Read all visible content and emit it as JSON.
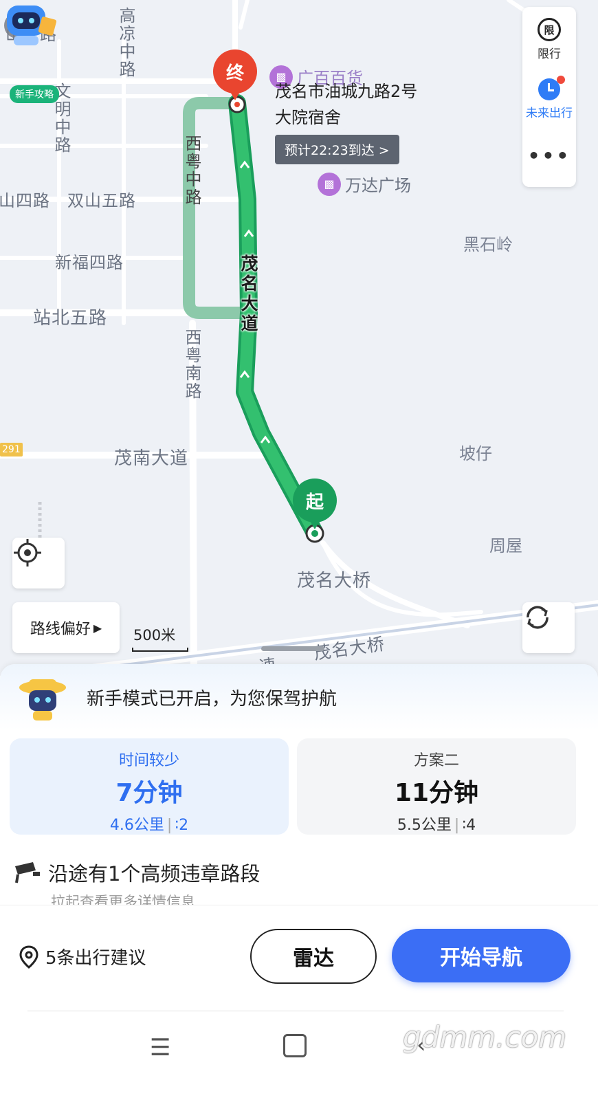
{
  "map": {
    "road_labels": {
      "shansan": "山三路",
      "gaoliang": "高凉中路",
      "wenming": "文明中路",
      "shan4": "山四路",
      "shuangshan5": "双山五路",
      "xinfu4": "新福四路",
      "zhanbei5": "站北五路",
      "xiyue_zhong": "西粤中路",
      "xiyue_nan": "西粤南路",
      "maonan": "茂南大道",
      "maoming_dadao": "茂名大道",
      "maoming_bridge": "茂名大桥",
      "maoming_bridge2": "茂名大桥",
      "road_partial": "一速",
      "shield": "291"
    },
    "places": {
      "heishiling": "黑石岭",
      "pozai": "坡仔",
      "zhouwu": "周屋"
    },
    "pois": {
      "guangbai": "广百百货",
      "wanda": "万达广场"
    },
    "destination": {
      "pin_label": "终",
      "name": "茂名市油城九路2号大院宿舍",
      "eta": "预计22:23到达 >"
    },
    "start": {
      "pin_label": "起"
    },
    "scale": "500米",
    "route_preference": "路线偏好",
    "mascot_label": "新手攻略"
  },
  "right_panel": {
    "restriction_icon": "限",
    "restriction_label": "限行",
    "future_label": "未来出行"
  },
  "sheet": {
    "tip": "新手模式已开启，为您保驾护航",
    "routes": [
      {
        "tag": "时间较少",
        "time": "7分钟",
        "distance": "4.6公里",
        "lights": "2"
      },
      {
        "tag": "方案二",
        "time": "11分钟",
        "distance": "5.5公里",
        "lights": "4"
      }
    ],
    "warning": "沿途有1个高频违章路段",
    "warning_sub": "拉起查看更多详情信息"
  },
  "actions": {
    "suggestions": "5条出行建议",
    "radar": "雷达",
    "start_nav": "开始导航"
  },
  "watermark": "gdmm.com",
  "colors": {
    "route": "#1a9e5b",
    "alt_route": "#8cc9aa",
    "accent": "#3b6ef5",
    "end_pin": "#e9452f"
  }
}
